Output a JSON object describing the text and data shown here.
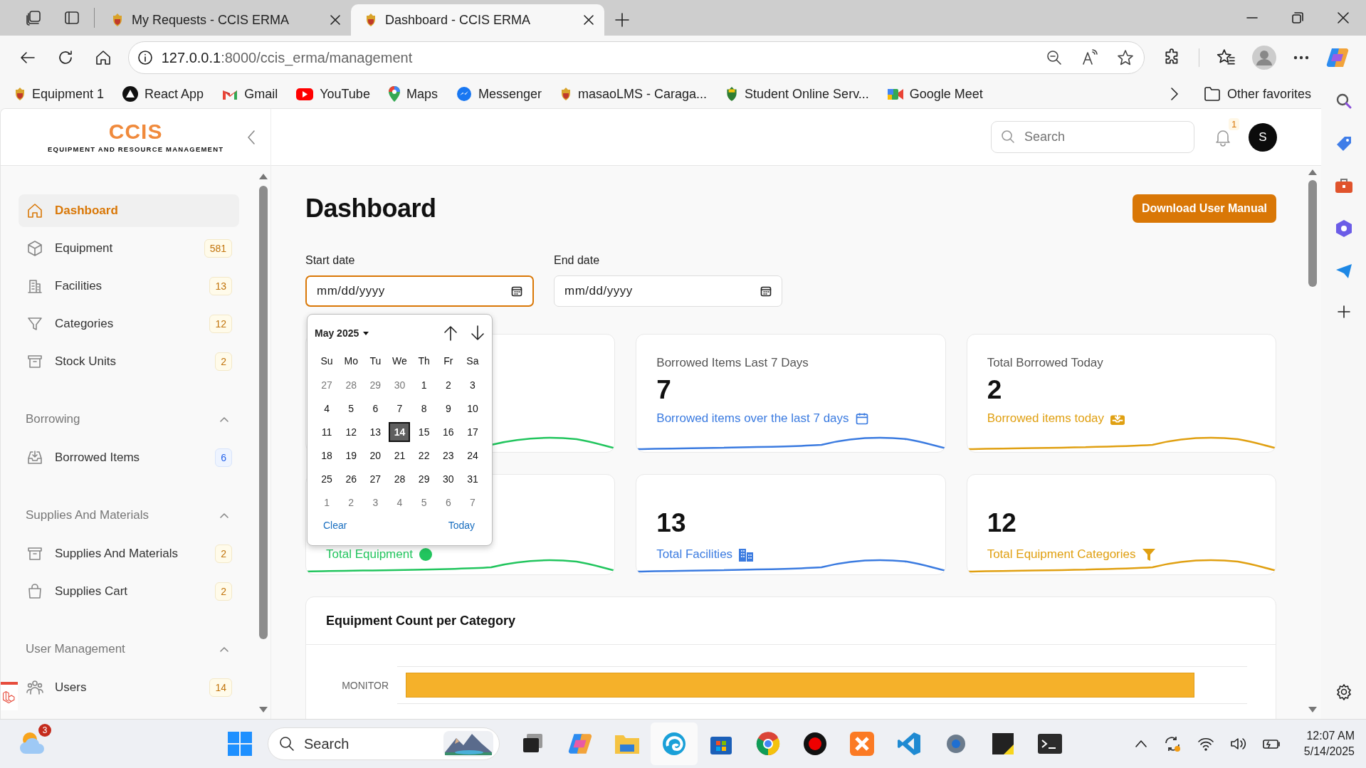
{
  "browser": {
    "tabs": [
      {
        "title": "My Requests - CCIS ERMA",
        "selected": false
      },
      {
        "title": "Dashboard - CCIS ERMA",
        "selected": true
      }
    ],
    "url_host": "127.0.0.1",
    "url_path": ":8000/ccis_erma/management",
    "bookmarks": [
      "Equipment 1",
      "React App",
      "Gmail",
      "YouTube",
      "Maps",
      "Messenger",
      "masaoLMS - Caraga...",
      "Student Online Serv...",
      "Google Meet"
    ],
    "other_favorites": "Other favorites"
  },
  "app": {
    "logo_title": "CCIS",
    "logo_subtitle": "EQUIPMENT AND RESOURCE MANAGEMENT",
    "search_placeholder": "Search",
    "notification_count": "1",
    "avatar_letter": "S"
  },
  "sidebar": {
    "sections": [
      {
        "items": [
          {
            "label": "Dashboard",
            "selected": true
          },
          {
            "label": "Equipment",
            "count": "581",
            "color": "#c2740c",
            "selected": false
          },
          {
            "label": "Facilities",
            "count": "13",
            "color": "#c2740c",
            "selected": false
          },
          {
            "label": "Categories",
            "count": "12",
            "color": "#c2740c",
            "selected": false
          },
          {
            "label": "Stock Units",
            "count": "2",
            "color": "#c2740c",
            "selected": false
          }
        ]
      },
      {
        "heading": "Borrowing",
        "expanded": true,
        "items": [
          {
            "label": "Borrowed Items",
            "count": "6",
            "color": "#2563eb",
            "selected": false
          }
        ]
      },
      {
        "heading": "Supplies And Materials",
        "expanded": true,
        "items": [
          {
            "label": "Supplies And Materials",
            "count": "2",
            "color": "#c2740c",
            "selected": false
          },
          {
            "label": "Supplies Cart",
            "count": "2",
            "color": "#c2740c",
            "selected": false
          }
        ]
      },
      {
        "heading": "User Management",
        "expanded": true,
        "items": [
          {
            "label": "Users",
            "count": "14",
            "color": "#c2740c",
            "selected": false
          }
        ]
      }
    ]
  },
  "main": {
    "title": "Dashboard",
    "download_button": "Download User Manual",
    "filters": [
      {
        "label": "Start date",
        "placeholder": "mm/dd/yyyy",
        "focused": true
      },
      {
        "label": "End date",
        "placeholder": "mm/dd/yyyy",
        "focused": false
      }
    ],
    "calendar": {
      "month": "May 2025",
      "weekdays": [
        "Su",
        "Mo",
        "Tu",
        "We",
        "Th",
        "Fr",
        "Sa"
      ],
      "weeks": [
        [
          {
            "d": "27",
            "outside": true,
            "selected": false
          },
          {
            "d": "28",
            "outside": true,
            "selected": false
          },
          {
            "d": "29",
            "outside": true,
            "selected": false
          },
          {
            "d": "30",
            "outside": true,
            "selected": false
          },
          {
            "d": "1",
            "outside": false,
            "selected": false
          },
          {
            "d": "2",
            "outside": false,
            "selected": false
          },
          {
            "d": "3",
            "outside": false,
            "selected": false
          }
        ],
        [
          {
            "d": "4",
            "outside": false,
            "selected": false
          },
          {
            "d": "5",
            "outside": false,
            "selected": false
          },
          {
            "d": "6",
            "outside": false,
            "selected": false
          },
          {
            "d": "7",
            "outside": false,
            "selected": false
          },
          {
            "d": "8",
            "outside": false,
            "selected": false
          },
          {
            "d": "9",
            "outside": false,
            "selected": false
          },
          {
            "d": "10",
            "outside": false,
            "selected": false
          }
        ],
        [
          {
            "d": "11",
            "outside": false,
            "selected": false
          },
          {
            "d": "12",
            "outside": false,
            "selected": false
          },
          {
            "d": "13",
            "outside": false,
            "selected": false
          },
          {
            "d": "14",
            "outside": false,
            "selected": true
          },
          {
            "d": "15",
            "outside": false,
            "selected": false
          },
          {
            "d": "16",
            "outside": false,
            "selected": false
          },
          {
            "d": "17",
            "outside": false,
            "selected": false
          }
        ],
        [
          {
            "d": "18",
            "outside": false,
            "selected": false
          },
          {
            "d": "19",
            "outside": false,
            "selected": false
          },
          {
            "d": "20",
            "outside": false,
            "selected": false
          },
          {
            "d": "21",
            "outside": false,
            "selected": false
          },
          {
            "d": "22",
            "outside": false,
            "selected": false
          },
          {
            "d": "23",
            "outside": false,
            "selected": false
          },
          {
            "d": "24",
            "outside": false,
            "selected": false
          }
        ],
        [
          {
            "d": "25",
            "outside": false,
            "selected": false
          },
          {
            "d": "26",
            "outside": false,
            "selected": false
          },
          {
            "d": "27",
            "outside": false,
            "selected": false
          },
          {
            "d": "28",
            "outside": false,
            "selected": false
          },
          {
            "d": "29",
            "outside": false,
            "selected": false
          },
          {
            "d": "30",
            "outside": false,
            "selected": false
          },
          {
            "d": "31",
            "outside": false,
            "selected": false
          }
        ],
        [
          {
            "d": "1",
            "outside": true,
            "selected": false
          },
          {
            "d": "2",
            "outside": true,
            "selected": false
          },
          {
            "d": "3",
            "outside": true,
            "selected": false
          },
          {
            "d": "4",
            "outside": true,
            "selected": false
          },
          {
            "d": "5",
            "outside": true,
            "selected": false
          },
          {
            "d": "6",
            "outside": true,
            "selected": false
          },
          {
            "d": "7",
            "outside": true,
            "selected": false
          }
        ]
      ],
      "clear": "Clear",
      "today": "Today"
    },
    "cards": [
      {
        "color": "#22c55e"
      },
      {
        "title": "Borrowed Items Last 7 Days",
        "value": "7",
        "caption": "Borrowed items over the last 7 days",
        "color": "#3b7be0"
      },
      {
        "title": "Total Borrowed Today",
        "value": "2",
        "caption": "Borrowed items today",
        "color": "#e0a012"
      },
      {
        "caption": "Total Equipment",
        "color": "#22c55e"
      },
      {
        "value": "13",
        "caption": "Total Facilities",
        "color": "#3b7be0"
      },
      {
        "value": "12",
        "caption": "Total Equipment Categories",
        "color": "#e0a012"
      }
    ],
    "chart": {
      "title": "Equipment Count per Category",
      "category_labels": [
        "MONITOR"
      ]
    }
  },
  "taskbar": {
    "weather_badge": "3",
    "search_placeholder": "Search",
    "time": "12:07 AM",
    "date": "5/14/2025"
  }
}
